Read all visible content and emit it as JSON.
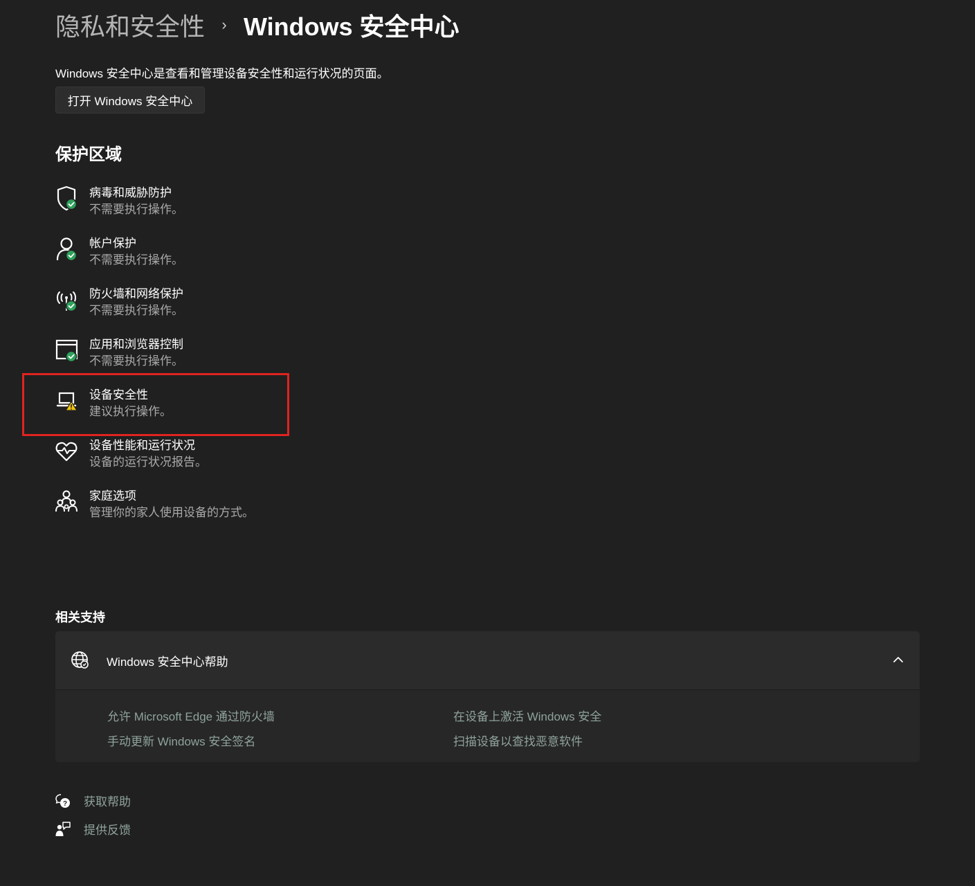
{
  "breadcrumb": {
    "parent": "隐私和安全性",
    "separator": "›",
    "current": "Windows 安全中心"
  },
  "description": "Windows 安全中心是查看和管理设备安全性和运行状况的页面。",
  "open_button_label": "打开 Windows 安全中心",
  "protection_areas": {
    "title": "保护区域",
    "items": [
      {
        "title": "病毒和威胁防护",
        "status": "不需要执行操作。",
        "icon": "shield-check-icon",
        "badge": "ok"
      },
      {
        "title": "帐户保护",
        "status": "不需要执行操作。",
        "icon": "account-check-icon",
        "badge": "ok"
      },
      {
        "title": "防火墙和网络保护",
        "status": "不需要执行操作。",
        "icon": "firewall-network-icon",
        "badge": "ok"
      },
      {
        "title": "应用和浏览器控制",
        "status": "不需要执行操作。",
        "icon": "app-browser-icon",
        "badge": "ok"
      },
      {
        "title": "设备安全性",
        "status": "建议执行操作。",
        "icon": "device-warning-icon",
        "badge": "warning"
      },
      {
        "title": "设备性能和运行状况",
        "status": "设备的运行状况报告。",
        "icon": "heart-pulse-icon",
        "badge": "none"
      },
      {
        "title": "家庭选项",
        "status": "管理你的家人使用设备的方式。",
        "icon": "family-icon",
        "badge": "none"
      }
    ]
  },
  "related_support": {
    "title": "相关支持",
    "help_header": "Windows 安全中心帮助",
    "links": [
      "允许 Microsoft Edge 通过防火墙",
      "在设备上激活 Windows 安全",
      "手动更新 Windows 安全签名",
      "扫描设备以查找恶意软件"
    ]
  },
  "footer": {
    "get_help": "获取帮助",
    "feedback": "提供反馈"
  },
  "colors": {
    "background": "#202020",
    "card": "#2b2b2b",
    "ok_badge": "#2ea15c",
    "warning_badge": "#f2c511",
    "highlight": "#e1231f",
    "link": "#8fa39a"
  }
}
